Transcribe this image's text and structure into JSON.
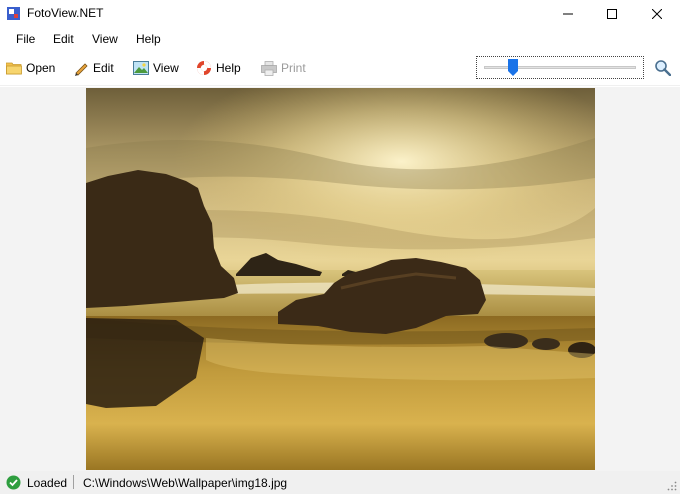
{
  "window": {
    "title": "FotoView.NET"
  },
  "menu": {
    "items": [
      "File",
      "Edit",
      "View",
      "Help"
    ]
  },
  "toolbar": {
    "open": "Open",
    "edit": "Edit",
    "view": "View",
    "help": "Help",
    "print": "Print"
  },
  "zoom": {
    "level_fraction": 0.17
  },
  "status": {
    "state": "Loaded",
    "path": "C:\\Windows\\Web\\Wallpaper\\img18.jpg"
  },
  "icons": {
    "app": "app-icon",
    "minimize": "minimize-icon",
    "maximize": "maximize-icon",
    "close": "close-icon",
    "open": "folder-icon",
    "edit": "pencil-icon",
    "view": "picture-icon",
    "help": "lifebuoy-icon",
    "print": "printer-icon",
    "zoom": "magnifier-icon",
    "status": "check-circle-icon"
  },
  "colors": {
    "accent": "#1a73e8",
    "status_ok": "#2e9e3f",
    "disabled": "#9a9a9a"
  }
}
